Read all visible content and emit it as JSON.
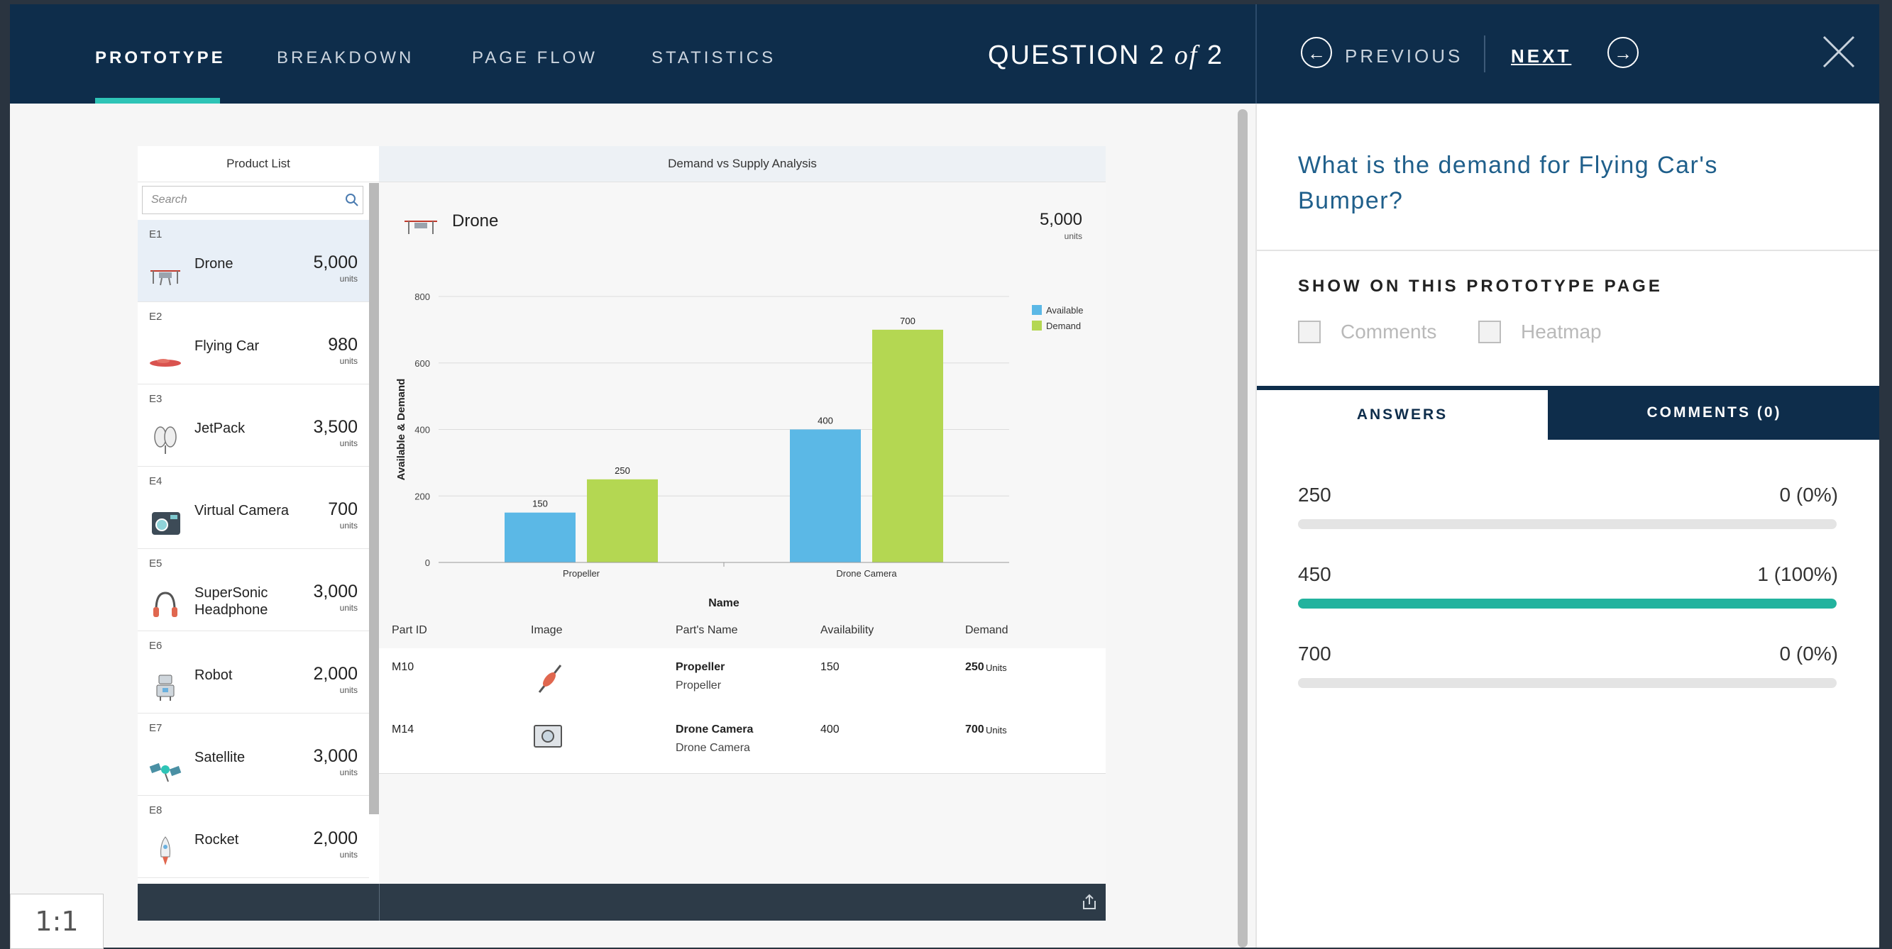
{
  "nav": {
    "tabs": [
      {
        "label": "PROTOTYPE"
      },
      {
        "label": "BREAKDOWN"
      },
      {
        "label": "PAGE FLOW"
      },
      {
        "label": "STATISTICS"
      }
    ],
    "question_label": "QUESTION 2",
    "question_of": "of",
    "question_total": "2",
    "previous_label": "PREVIOUS",
    "next_label": "NEXT"
  },
  "prototype": {
    "list_title": "Product List",
    "search_placeholder": "Search",
    "items": [
      {
        "id": "E1",
        "name": "Drone",
        "value": "5,000",
        "unit": "units"
      },
      {
        "id": "E2",
        "name": "Flying Car",
        "value": "980",
        "unit": "units"
      },
      {
        "id": "E3",
        "name": "JetPack",
        "value": "3,500",
        "unit": "units"
      },
      {
        "id": "E4",
        "name": "Virtual Camera",
        "value": "700",
        "unit": "units"
      },
      {
        "id": "E5",
        "name": "SuperSonic Headphone",
        "value": "3,000",
        "unit": "units"
      },
      {
        "id": "E6",
        "name": "Robot",
        "value": "2,000",
        "unit": "units"
      },
      {
        "id": "E7",
        "name": "Satellite",
        "value": "3,000",
        "unit": "units"
      },
      {
        "id": "E8",
        "name": "Rocket",
        "value": "2,000",
        "unit": "units"
      }
    ],
    "detail_title": "Demand vs Supply Analysis",
    "selected_name": "Drone",
    "selected_value": "5,000",
    "selected_unit": "units",
    "table": {
      "headers": [
        "Part ID",
        "Image",
        "Part's Name",
        "Availability",
        "Demand"
      ],
      "rows": [
        {
          "id": "M10",
          "name": "Propeller",
          "sub": "Propeller",
          "availability": "150",
          "demand": "250",
          "demand_unit": "Units"
        },
        {
          "id": "M14",
          "name": "Drone Camera",
          "sub": "Drone Camera",
          "availability": "400",
          "demand": "700",
          "demand_unit": "Units"
        }
      ]
    }
  },
  "chart_data": {
    "type": "bar",
    "categories": [
      "Propeller",
      "Drone Camera"
    ],
    "series": [
      {
        "name": "Available",
        "values": [
          150,
          400
        ],
        "color": "#5bb8e6"
      },
      {
        "name": "Demand",
        "values": [
          250,
          700
        ],
        "color": "#b4d752"
      }
    ],
    "xlabel": "Name",
    "ylabel": "Available & Demand",
    "ylim": [
      0,
      800
    ],
    "yticks": [
      0,
      200,
      400,
      600,
      800
    ],
    "legend": "top-right",
    "grid": true
  },
  "question": {
    "text": "What is the demand for Flying Car's Bumper?",
    "show_label": "SHOW ON THIS PROTOTYPE PAGE",
    "comments_label": "Comments",
    "heatmap_label": "Heatmap",
    "tab_answers": "ANSWERS",
    "tab_comments": "COMMENTS (0)",
    "answers": [
      {
        "label": "250",
        "count": "0 (0%)",
        "fraction": 0
      },
      {
        "label": "450",
        "count": "1 (100%)",
        "fraction": 1
      },
      {
        "label": "700",
        "count": "0 (0%)",
        "fraction": 0
      }
    ]
  },
  "zoom": "1:1",
  "colors": {
    "header": "#0e2d4b",
    "accent": "#2ec4b6",
    "bar_fill": "#22b39e",
    "question": "#1f5f8b"
  }
}
